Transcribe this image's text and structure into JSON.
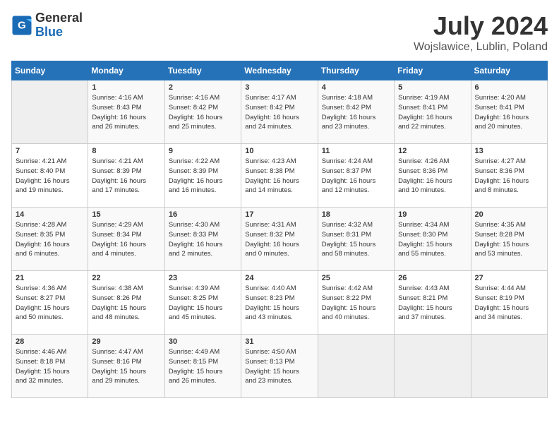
{
  "header": {
    "logo_line1": "General",
    "logo_line2": "Blue",
    "month": "July 2024",
    "location": "Wojslawice, Lublin, Poland"
  },
  "weekdays": [
    "Sunday",
    "Monday",
    "Tuesday",
    "Wednesday",
    "Thursday",
    "Friday",
    "Saturday"
  ],
  "weeks": [
    [
      {
        "day": "",
        "empty": true
      },
      {
        "day": "1",
        "rise": "4:16 AM",
        "set": "8:43 PM",
        "dl": "16 hours and 26 minutes."
      },
      {
        "day": "2",
        "rise": "4:16 AM",
        "set": "8:42 PM",
        "dl": "16 hours and 25 minutes."
      },
      {
        "day": "3",
        "rise": "4:17 AM",
        "set": "8:42 PM",
        "dl": "16 hours and 24 minutes."
      },
      {
        "day": "4",
        "rise": "4:18 AM",
        "set": "8:42 PM",
        "dl": "16 hours and 23 minutes."
      },
      {
        "day": "5",
        "rise": "4:19 AM",
        "set": "8:41 PM",
        "dl": "16 hours and 22 minutes."
      },
      {
        "day": "6",
        "rise": "4:20 AM",
        "set": "8:41 PM",
        "dl": "16 hours and 20 minutes."
      }
    ],
    [
      {
        "day": "7",
        "rise": "4:21 AM",
        "set": "8:40 PM",
        "dl": "16 hours and 19 minutes."
      },
      {
        "day": "8",
        "rise": "4:21 AM",
        "set": "8:39 PM",
        "dl": "16 hours and 17 minutes."
      },
      {
        "day": "9",
        "rise": "4:22 AM",
        "set": "8:39 PM",
        "dl": "16 hours and 16 minutes."
      },
      {
        "day": "10",
        "rise": "4:23 AM",
        "set": "8:38 PM",
        "dl": "16 hours and 14 minutes."
      },
      {
        "day": "11",
        "rise": "4:24 AM",
        "set": "8:37 PM",
        "dl": "16 hours and 12 minutes."
      },
      {
        "day": "12",
        "rise": "4:26 AM",
        "set": "8:36 PM",
        "dl": "16 hours and 10 minutes."
      },
      {
        "day": "13",
        "rise": "4:27 AM",
        "set": "8:36 PM",
        "dl": "16 hours and 8 minutes."
      }
    ],
    [
      {
        "day": "14",
        "rise": "4:28 AM",
        "set": "8:35 PM",
        "dl": "16 hours and 6 minutes."
      },
      {
        "day": "15",
        "rise": "4:29 AM",
        "set": "8:34 PM",
        "dl": "16 hours and 4 minutes."
      },
      {
        "day": "16",
        "rise": "4:30 AM",
        "set": "8:33 PM",
        "dl": "16 hours and 2 minutes."
      },
      {
        "day": "17",
        "rise": "4:31 AM",
        "set": "8:32 PM",
        "dl": "16 hours and 0 minutes."
      },
      {
        "day": "18",
        "rise": "4:32 AM",
        "set": "8:31 PM",
        "dl": "15 hours and 58 minutes."
      },
      {
        "day": "19",
        "rise": "4:34 AM",
        "set": "8:30 PM",
        "dl": "15 hours and 55 minutes."
      },
      {
        "day": "20",
        "rise": "4:35 AM",
        "set": "8:28 PM",
        "dl": "15 hours and 53 minutes."
      }
    ],
    [
      {
        "day": "21",
        "rise": "4:36 AM",
        "set": "8:27 PM",
        "dl": "15 hours and 50 minutes."
      },
      {
        "day": "22",
        "rise": "4:38 AM",
        "set": "8:26 PM",
        "dl": "15 hours and 48 minutes."
      },
      {
        "day": "23",
        "rise": "4:39 AM",
        "set": "8:25 PM",
        "dl": "15 hours and 45 minutes."
      },
      {
        "day": "24",
        "rise": "4:40 AM",
        "set": "8:23 PM",
        "dl": "15 hours and 43 minutes."
      },
      {
        "day": "25",
        "rise": "4:42 AM",
        "set": "8:22 PM",
        "dl": "15 hours and 40 minutes."
      },
      {
        "day": "26",
        "rise": "4:43 AM",
        "set": "8:21 PM",
        "dl": "15 hours and 37 minutes."
      },
      {
        "day": "27",
        "rise": "4:44 AM",
        "set": "8:19 PM",
        "dl": "15 hours and 34 minutes."
      }
    ],
    [
      {
        "day": "28",
        "rise": "4:46 AM",
        "set": "8:18 PM",
        "dl": "15 hours and 32 minutes."
      },
      {
        "day": "29",
        "rise": "4:47 AM",
        "set": "8:16 PM",
        "dl": "15 hours and 29 minutes."
      },
      {
        "day": "30",
        "rise": "4:49 AM",
        "set": "8:15 PM",
        "dl": "15 hours and 26 minutes."
      },
      {
        "day": "31",
        "rise": "4:50 AM",
        "set": "8:13 PM",
        "dl": "15 hours and 23 minutes."
      },
      {
        "day": "",
        "empty": true
      },
      {
        "day": "",
        "empty": true
      },
      {
        "day": "",
        "empty": true
      }
    ]
  ]
}
